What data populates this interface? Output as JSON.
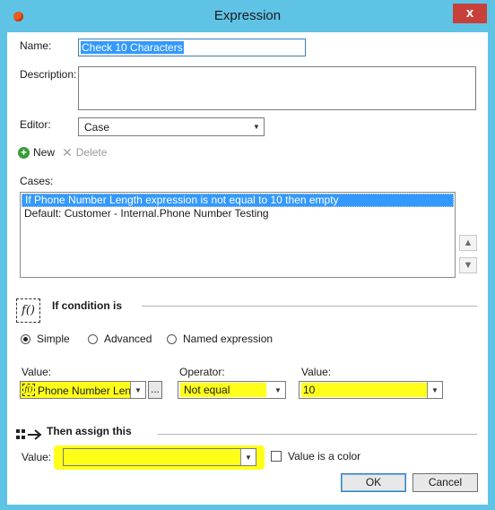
{
  "window": {
    "title": "Expression",
    "close_symbol": "x"
  },
  "form": {
    "name_label": "Name:",
    "name_value": "Check 10 Characters",
    "description_label": "Description:",
    "description_value": "",
    "editor_label": "Editor:",
    "editor_value": "Case"
  },
  "toolbar": {
    "new_label": "New",
    "delete_label": "Delete"
  },
  "cases": {
    "label": "Cases:",
    "items": [
      "If Phone Number Length expression is not equal to 10 then empty",
      "Default: Customer - Internal.Phone Number Testing"
    ],
    "selected_index": 0
  },
  "condition": {
    "title": "If condition is",
    "icon_text": "f()",
    "radio_simple": "Simple",
    "radio_advanced": "Advanced",
    "radio_named": "Named expression",
    "selected_radio": "Simple",
    "value_label": "Value:",
    "value_icon_text": "f()",
    "value_text": "Phone Number Length",
    "ellipsis": "...",
    "operator_label": "Operator:",
    "operator_value": "Not equal",
    "value2_label": "Value:",
    "value2_text": "10"
  },
  "assign": {
    "title": "Then assign this",
    "value_label": "Value:",
    "value_text": "",
    "color_checkbox_label": "Value is a color",
    "color_checked": false
  },
  "buttons": {
    "ok": "OK",
    "cancel": "Cancel"
  },
  "colors": {
    "titlebar": "#5fc3e6",
    "highlight": "#ffff1a",
    "selection": "#3399ff",
    "close": "#c7403a"
  }
}
